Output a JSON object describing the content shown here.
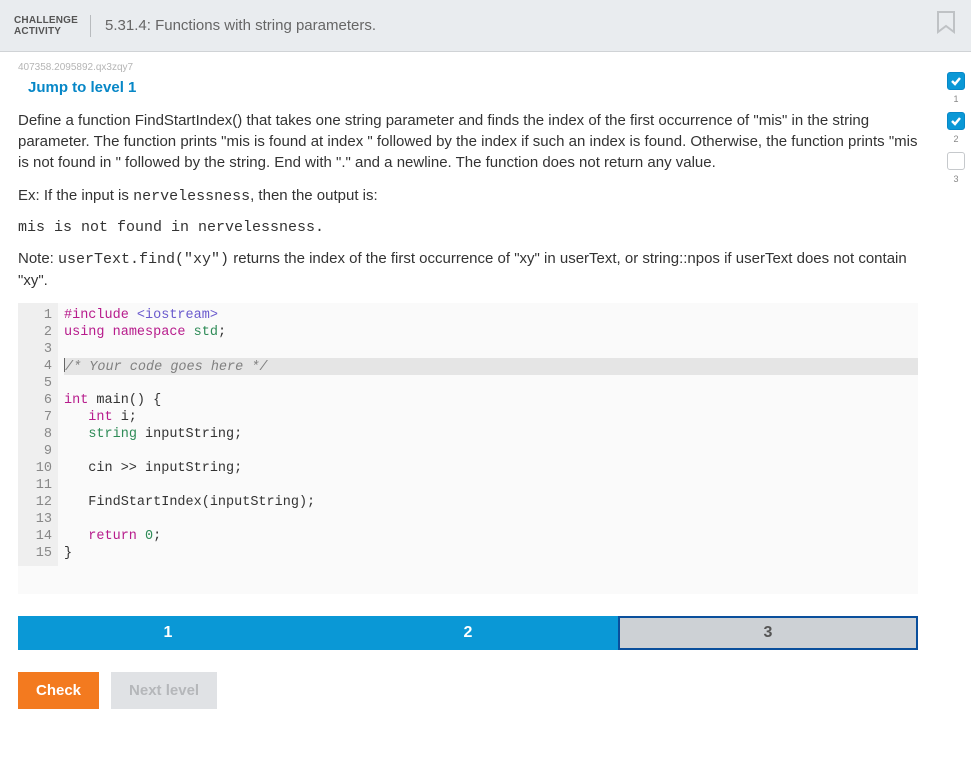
{
  "header": {
    "label_line1": "CHALLENGE",
    "label_line2": "ACTIVITY",
    "title": "5.31.4: Functions with string parameters."
  },
  "hashid": "407358.2095892.qx3zqy7",
  "jump": "Jump to level 1",
  "para1": "Define a function FindStartIndex() that takes one string parameter and finds the index of the first occurrence of \"mis\" in the string parameter. The function prints \"mis is found at index \" followed by the index if such an index is found. Otherwise, the function prints \"mis is not found in \" followed by the string. End with \".\" and a newline. The function does not return any value.",
  "ex_prefix": "Ex: If the input is ",
  "ex_input": "nervelessness",
  "ex_suffix": ", then the output is:",
  "ex_output": "mis is not found in nervelessness.",
  "note_pre": "Note: ",
  "note_code": "userText.find(\"xy\")",
  "note_post": " returns the index of the first occurrence of \"xy\" in userText, or string::npos if userText does not contain \"xy\".",
  "code": {
    "l1_a": "#include",
    "l1_b": " <iostream>",
    "l2_a": "using",
    "l2_b": " namespace",
    "l2_c": " std",
    "l2_d": ";",
    "l4": "/* Your code goes here */",
    "l6_a": "int",
    "l6_b": " main() {",
    "l7_a": "   int",
    "l7_b": " i;",
    "l8_a": "   ",
    "l8_b": "string",
    "l8_c": " inputString;",
    "l10": "   cin >> inputString;",
    "l12": "   FindStartIndex(inputString);",
    "l14_a": "   return",
    "l14_b": " ",
    "l14_c": "0",
    "l14_d": ";",
    "l15": "}"
  },
  "gutter": [
    "1",
    "2",
    "3",
    "4",
    "5",
    "6",
    "7",
    "8",
    "9",
    "10",
    "11",
    "12",
    "13",
    "14",
    "15"
  ],
  "progress": {
    "p1": "1",
    "p2": "2",
    "p3": "3"
  },
  "side": {
    "n1": "1",
    "n2": "2",
    "n3": "3"
  },
  "buttons": {
    "check": "Check",
    "next": "Next level"
  }
}
